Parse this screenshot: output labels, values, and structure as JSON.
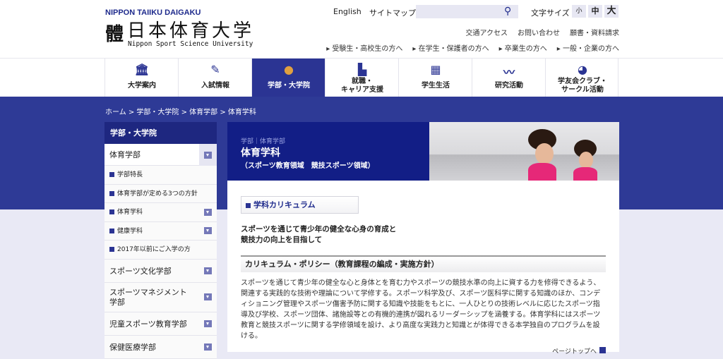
{
  "header": {
    "brand_en": "NIPPON TAIIKU DAIGAKU",
    "logo_mark": "體",
    "brand_jp": "日本体育大学",
    "brand_sub": "Nippon Sport Science University",
    "english": "English",
    "sitemap": "サイトマップ",
    "search_placeholder": "",
    "font_size_label": "文字サイズ",
    "font_sizes": [
      "小",
      "中",
      "大"
    ],
    "sub_links": [
      "交通アクセス",
      "お問い合わせ",
      "願書・資料請求"
    ],
    "audience_links": [
      "受験生・高校生の方へ",
      "在学生・保護者の方へ",
      "卒業生の方へ",
      "一般・企業の方へ"
    ]
  },
  "nav": [
    {
      "label": "大学案内",
      "icon": "building-icon"
    },
    {
      "label": "入試情報",
      "icon": "pencil-icon"
    },
    {
      "label": "学部・大学院",
      "icon": "pins-icon"
    },
    {
      "label": "就職・\nキャリア支援",
      "icon": "city-icon"
    },
    {
      "label": "学生生活",
      "icon": "calendar-icon"
    },
    {
      "label": "研究活動",
      "icon": "chart-line-icon"
    },
    {
      "label": "学友会クラブ・\nサークル活動",
      "icon": "ball-icon"
    }
  ],
  "breadcrumb": "ホーム > 学部・大学院 > 体育学部 > 体育学科",
  "sidebar": {
    "heading": "学部・大学院",
    "items": [
      "体育学部",
      "学部特長",
      "体育学部が定める3つの方針",
      "体育学科",
      "健康学科",
      "2017年以前にご入学の方",
      "スポーツ文化学部",
      "スポーツマネジメント学部",
      "児童スポーツ教育学部",
      "保健医療学部"
    ]
  },
  "main": {
    "hero_crumb": "学部｜体育学部",
    "hero_title": "体育学科",
    "hero_sub": "（スポーツ教育領域　競技スポーツ領域）",
    "tab": "学科カリキュラム",
    "lead": "スポーツを通じて青少年の健全な心身の育成と\n競技力の向上を目指して",
    "policy_heading": "カリキュラム・ポリシー（教育課程の編成・実施方針）",
    "policy_body": "スポーツを通じて青少年の健全な心と身体とを育む力やスポーツの競技水準の向上に資する力を修得できるよう、関連する実践的な技術や理論について学修する。スポーツ科学及び、スポーツ医科学に関する知識のほか、コンディショニング管理やスポーツ傷害予防に関する知識や技能をもとに、一人ひとりの技術レベルに応じたスポーツ指導及び学校、スポーツ団体、諸施設等との有機的連携が図れるリーダーシップを涵養する。体育学科にはスポーツ教育と競技スポーツに関する学修領域を設け、より高度な実践力と知識とが体得できる本学独自のプログラムを設ける。",
    "page_top": "ページトップへ"
  },
  "colors": {
    "primary": "#2b3493",
    "dark": "#121e86",
    "bg": "#e9e9f5"
  }
}
